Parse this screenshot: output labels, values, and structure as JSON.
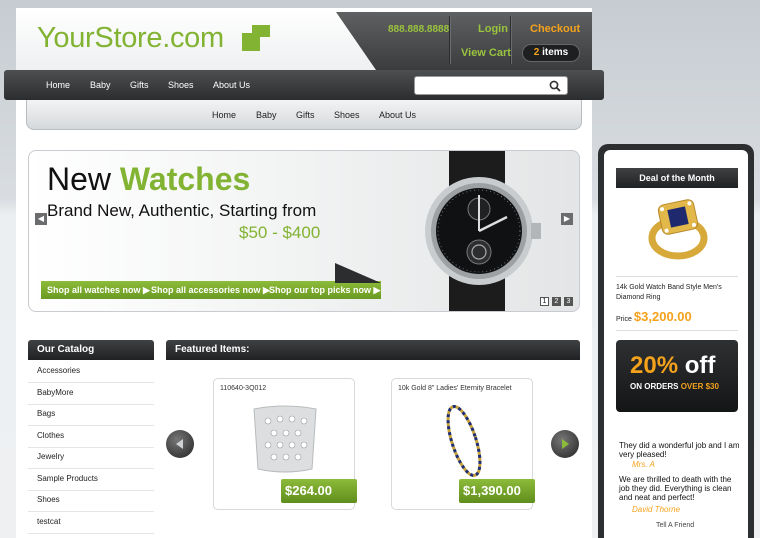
{
  "header": {
    "logo": "YourStore.com",
    "phone": "888.888.8888",
    "login": "Login",
    "checkout": "Checkout",
    "view_cart": "View Cart",
    "items_count": "2",
    "items_label": "items"
  },
  "main_nav": [
    "Home",
    "Baby",
    "Gifts",
    "Shoes",
    "About Us"
  ],
  "search": {
    "placeholder": "",
    "icon": "search-icon"
  },
  "sub_nav": [
    "Home",
    "Baby",
    "Gifts",
    "Shoes",
    "About Us"
  ],
  "banner": {
    "title_plain": "New",
    "title_accent": "Watches",
    "subtitle": "Brand New, Authentic, Starting from",
    "price_range": "$50 - $400",
    "links": [
      "Shop all watches now ▶",
      "Shop all accessories now ▶",
      "Shop our top picks now ▶"
    ],
    "pages": [
      "1",
      "2",
      "3"
    ],
    "active_page": "1"
  },
  "catalog": {
    "title": "Our Catalog",
    "items": [
      "Accessories",
      "BabyMore",
      "Bags",
      "Clothes",
      "Jewelry",
      "Sample Products",
      "Shoes",
      "testcat"
    ]
  },
  "featured": {
    "title": "Featured Items:",
    "products": [
      {
        "name": "110640-3Q012",
        "price": "$264.00"
      },
      {
        "name": "10k Gold 8\" Ladies' Eternity Bracelet",
        "price": "$1,390.00"
      }
    ]
  },
  "deal": {
    "title": "Deal of the Month",
    "name": "14k Gold Watch Band Style Men's Diamond Ring",
    "price_label": "Price",
    "price": "$3,200.00"
  },
  "promo": {
    "percent": "20%",
    "off": "off",
    "line_a": "ON ORDERS",
    "line_b": "OVER $30"
  },
  "testimonials": [
    {
      "text": "They did a wonderful job and I am very pleased!",
      "author": "Mrs. A"
    },
    {
      "text": "We are thrilled to death with the job they did. Everything is clean and neat and perfect!",
      "author": "David Thorne"
    }
  ],
  "tell_a_friend": "Tell A Friend",
  "colors": {
    "brand_green": "#82b332",
    "accent_orange": "#f4a21c",
    "dark": "#2c2d2e"
  }
}
